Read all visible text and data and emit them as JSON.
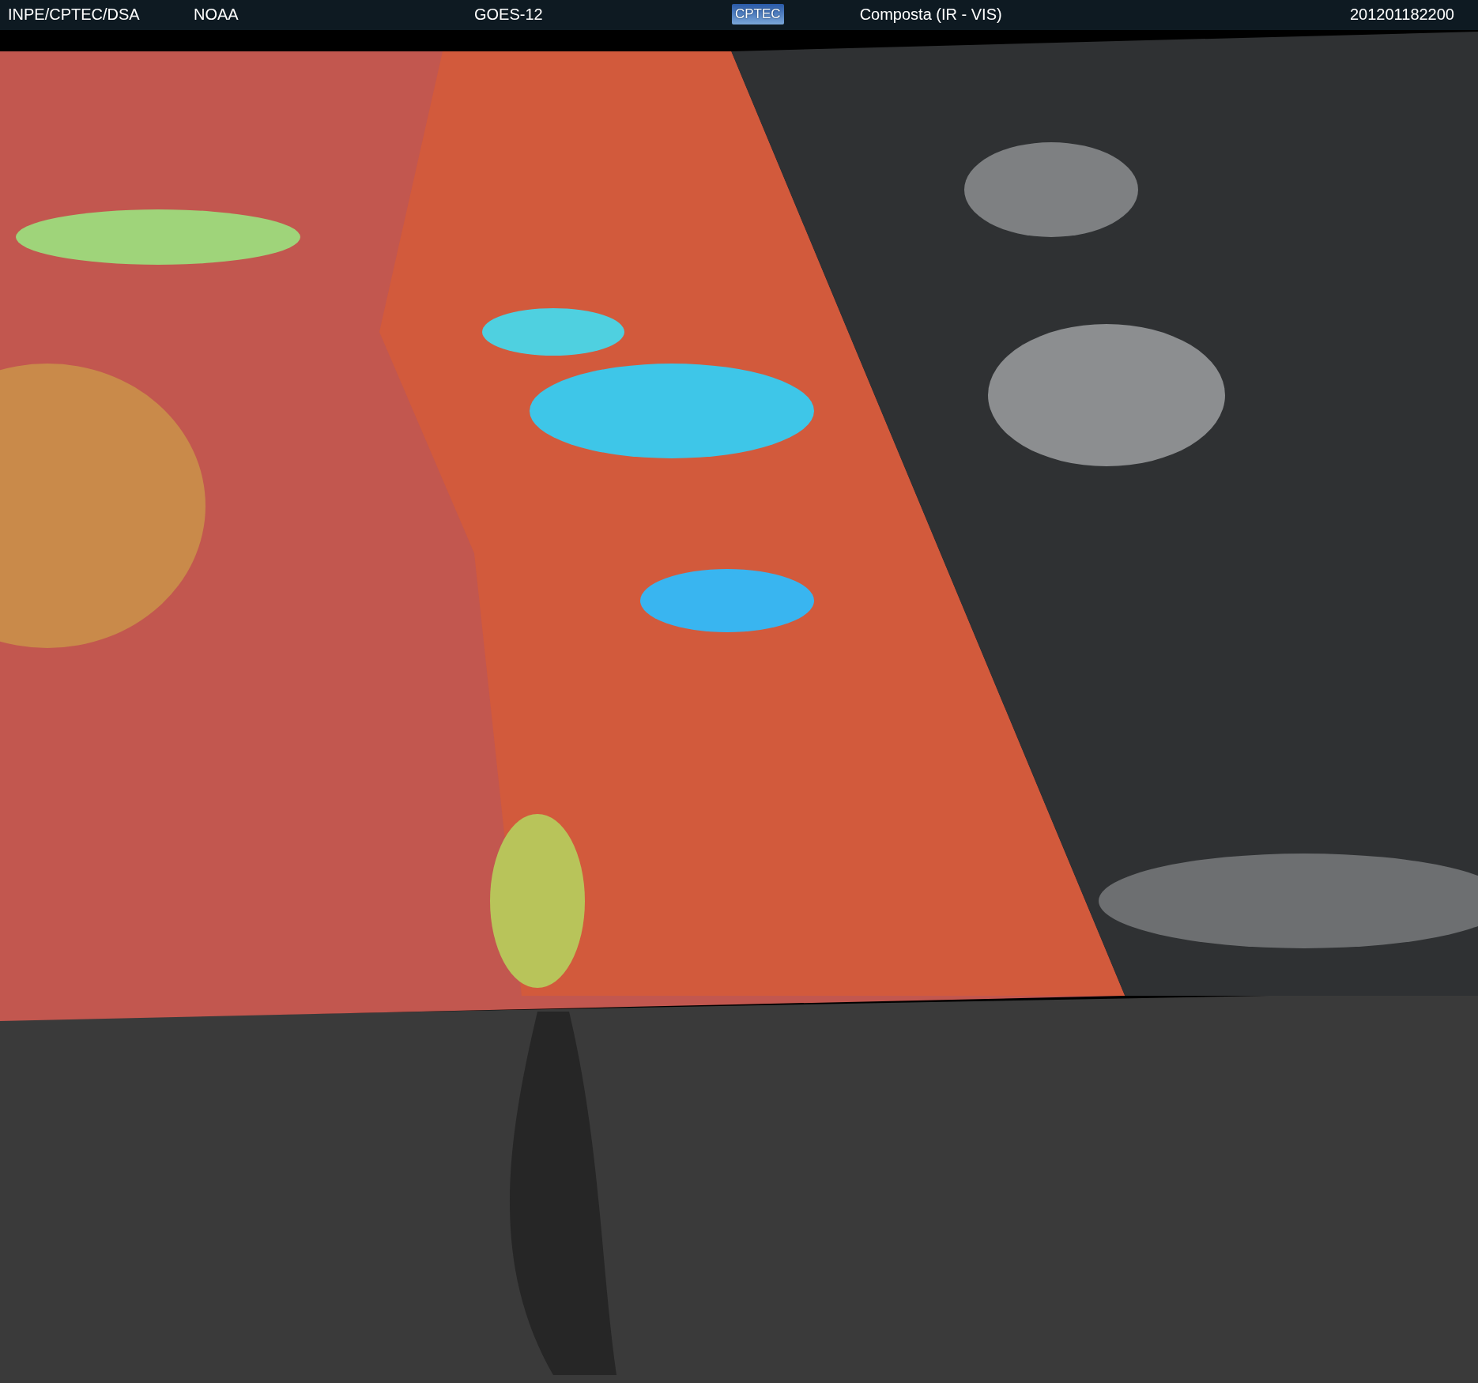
{
  "header": {
    "source": "INPE/CPTEC/DSA",
    "agency": "NOAA",
    "satellite": "GOES-12",
    "logo": "CPTEC",
    "product": "Composta (IR - VIS)",
    "timestamp": "201201182200"
  }
}
